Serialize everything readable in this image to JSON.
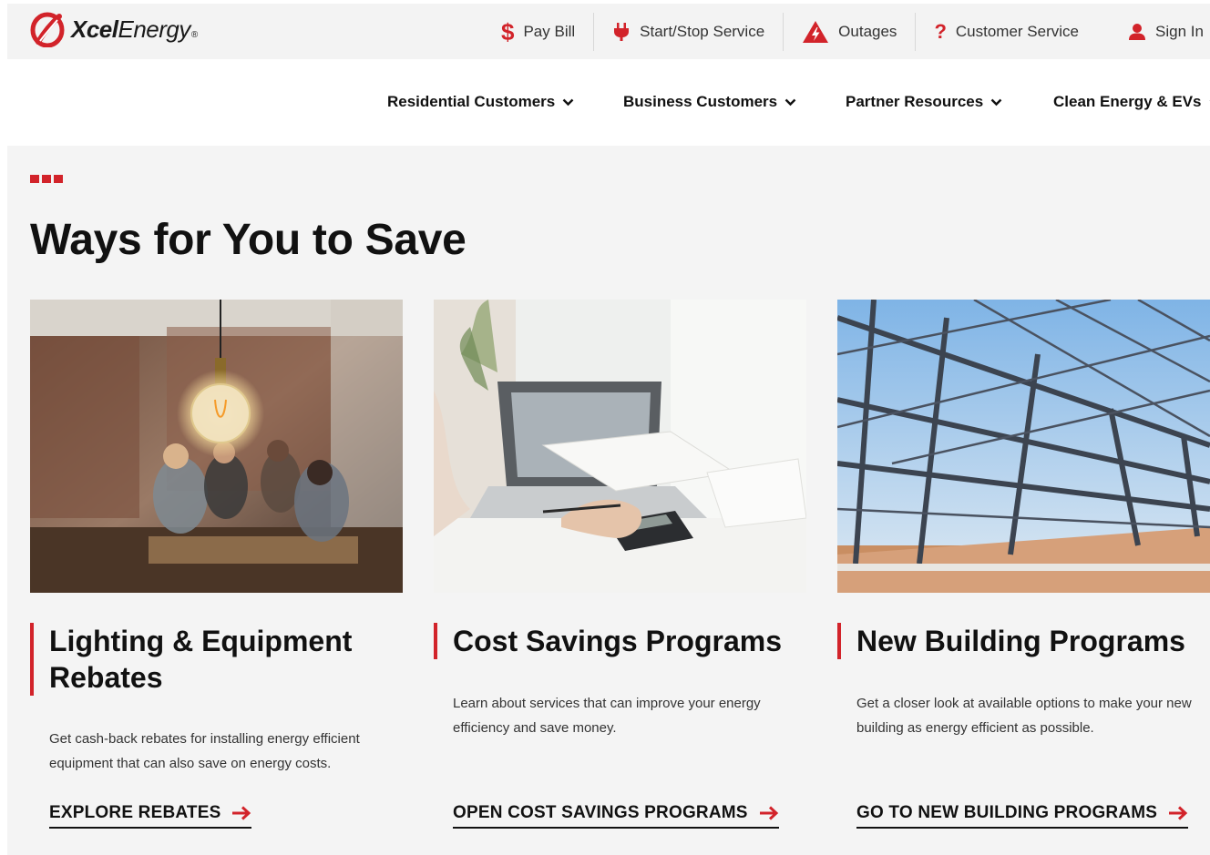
{
  "brand": {
    "name_bold": "Xcel",
    "name_light": "Energy",
    "reg": "®",
    "accent": "#d2232a"
  },
  "utility_nav": [
    {
      "label": "Pay Bill",
      "icon": "dollar-icon"
    },
    {
      "label": "Start/Stop Service",
      "icon": "plug-icon"
    },
    {
      "label": "Outages",
      "icon": "warning-bolt-icon"
    },
    {
      "label": "Customer Service",
      "icon": "question-icon"
    },
    {
      "label": "Sign In",
      "icon": "user-icon"
    }
  ],
  "main_nav": [
    {
      "label": "Residential Customers"
    },
    {
      "label": "Business Customers"
    },
    {
      "label": "Partner Resources"
    },
    {
      "label": "Clean Energy & EVs"
    }
  ],
  "section": {
    "title": "Ways for You to Save"
  },
  "cards": [
    {
      "title_lines": [
        "Lighting & Equipment",
        "Rebates"
      ],
      "description": "Get cash-back rebates for installing energy efficient equipment that can also save on energy costs.",
      "link": "EXPLORE REBATES",
      "image": "cafe-lightbulb-photo"
    },
    {
      "title_lines": [
        "Cost Savings Programs"
      ],
      "description": "Learn about services that can improve your energy efficiency and save money.",
      "link": "OPEN COST SAVINGS PROGRAMS",
      "image": "calculator-laptop-photo"
    },
    {
      "title_lines": [
        "New Building Programs"
      ],
      "description": "Get a closer look at available options to make your new building as energy efficient as possible.",
      "link": "GO TO NEW BUILDING PROGRAMS",
      "image": "steel-frame-construction-photo"
    }
  ]
}
